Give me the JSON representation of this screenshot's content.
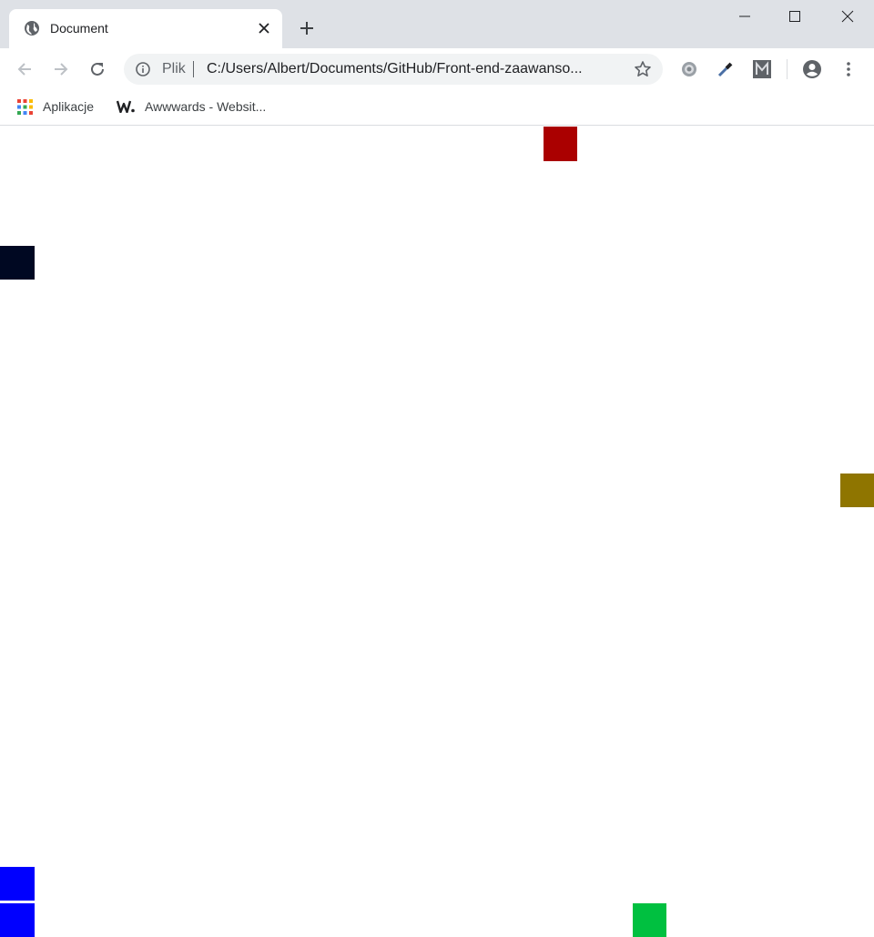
{
  "browser": {
    "tab": {
      "title": "Document",
      "favicon": "globe-icon"
    },
    "new_tab_icon": "plus-icon",
    "window_controls": [
      "minimize-icon",
      "maximize-icon",
      "close-icon"
    ],
    "address_bar": {
      "scheme_label": "Plik",
      "url": "C:/Users/Albert/Documents/GitHub/Front-end-zaawanso..."
    },
    "bookmarks": [
      {
        "label": "Aplikacje",
        "icon": "apps-grid-icon"
      },
      {
        "label": "Awwwards - Websit...",
        "icon": "awwwards-logo-icon"
      }
    ]
  },
  "page": {
    "background": "#ffffff",
    "squares": [
      {
        "name": "square-red",
        "color": "#aa0000"
      },
      {
        "name": "square-navy",
        "color": "#000822"
      },
      {
        "name": "square-olive",
        "color": "#8f7500"
      },
      {
        "name": "square-blue-1",
        "color": "#0000ff"
      },
      {
        "name": "square-blue-2",
        "color": "#0000ff"
      },
      {
        "name": "square-green",
        "color": "#00c040"
      }
    ]
  }
}
